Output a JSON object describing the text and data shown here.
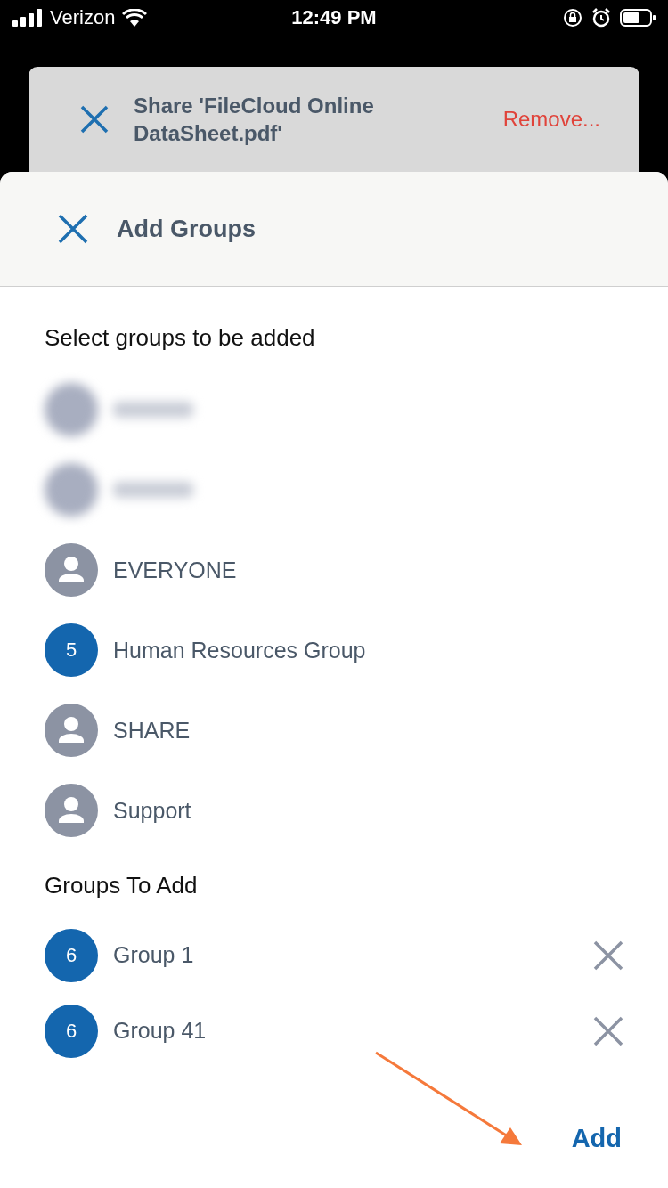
{
  "status_bar": {
    "carrier": "Verizon",
    "time": "12:49 PM"
  },
  "background_card": {
    "title": "Share 'FileCloud Online DataSheet.pdf'",
    "action": "Remove..."
  },
  "sheet": {
    "title": "Add Groups",
    "section_title": "Select groups to be added",
    "groups": [
      {
        "kind": "blurred"
      },
      {
        "kind": "blurred"
      },
      {
        "kind": "person",
        "name": "EVERYONE"
      },
      {
        "kind": "count",
        "badge": "5",
        "name": "Human Resources Group"
      },
      {
        "kind": "person",
        "name": "SHARE"
      },
      {
        "kind": "person",
        "name": "Support"
      }
    ],
    "to_add_title": "Groups To Add",
    "groups_to_add": [
      {
        "badge": "6",
        "name": "Group 1"
      },
      {
        "badge": "6",
        "name": "Group 41"
      }
    ],
    "add_button": "Add"
  }
}
